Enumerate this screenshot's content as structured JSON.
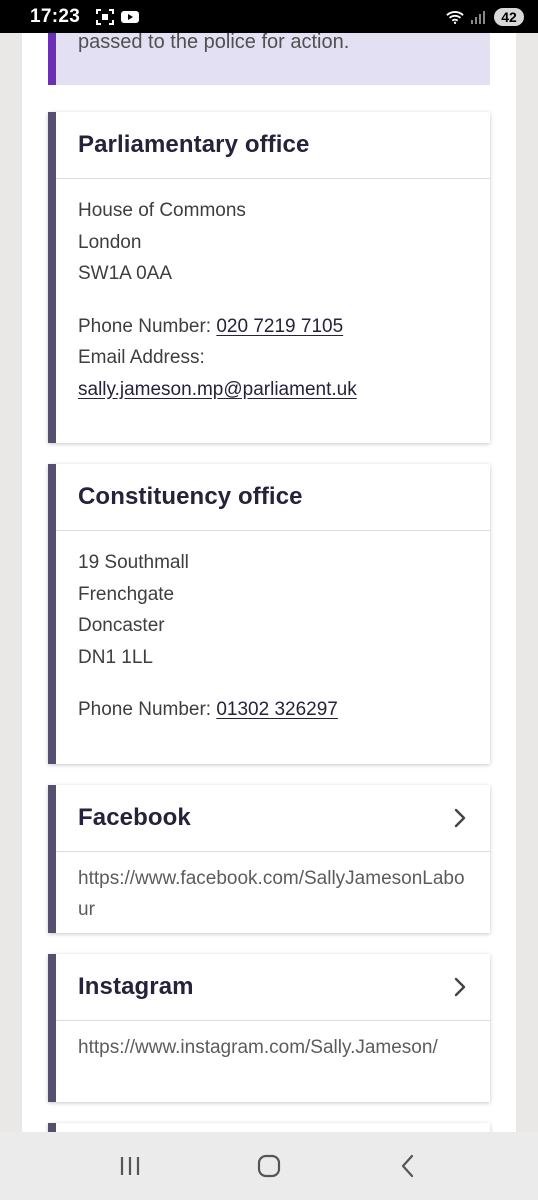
{
  "status_bar": {
    "time": "17:23",
    "battery": "42",
    "icons": [
      "screenshot-icon",
      "youtube-icon",
      "wifi-icon",
      "signal-icon"
    ]
  },
  "notice": {
    "text": "passed to the police for action."
  },
  "cards": {
    "parliamentary": {
      "title": "Parliamentary office",
      "address": [
        "House of Commons",
        "London",
        "SW1A 0AA"
      ],
      "phone_label": "Phone Number: ",
      "phone": "020 7219 7105",
      "email_label": "Email Address:",
      "email": "sally.jameson.mp@parliament.uk"
    },
    "constituency": {
      "title": "Constituency office",
      "address": [
        "19 Southmall",
        "Frenchgate",
        "Doncaster",
        "DN1 1LL"
      ],
      "phone_label": "Phone Number: ",
      "phone": "01302 326297"
    },
    "facebook": {
      "title": "Facebook",
      "url": "https://www.facebook.com/SallyJamesonLabour"
    },
    "instagram": {
      "title": "Instagram",
      "url": "https://www.instagram.com/Sally.Jameson/"
    }
  },
  "colors": {
    "card_accent": "#564f6f",
    "notice_accent": "#6b2fb5",
    "notice_bg": "#e3e0f3",
    "heading": "#27223b"
  }
}
